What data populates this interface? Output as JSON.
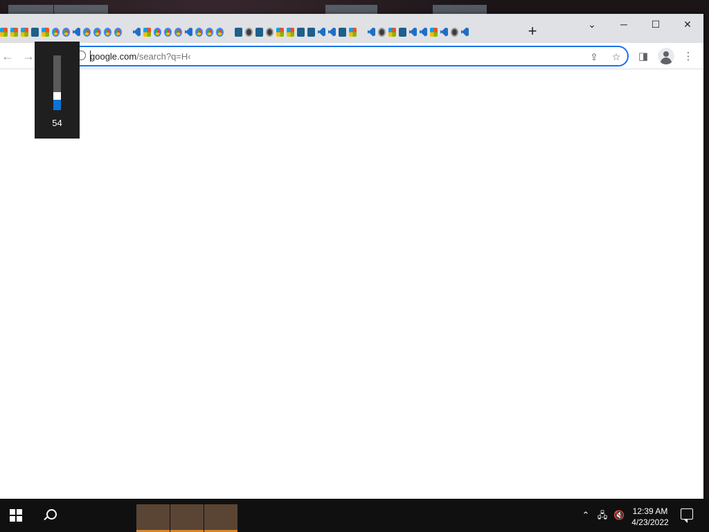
{
  "browser": {
    "tab_favicons": [
      "windows",
      "windows",
      "windows",
      "notion",
      "windows",
      "chrome",
      "chrome",
      "vscode",
      "chrome",
      "chrome",
      "chrome",
      "chrome",
      "gap",
      "vscode",
      "windows",
      "chrome",
      "chrome",
      "chrome",
      "vscode",
      "chrome",
      "chrome",
      "chrome",
      "gap",
      "notion",
      "github",
      "notion",
      "github",
      "windows",
      "windows",
      "notion",
      "notion",
      "vscode",
      "vscode",
      "notion",
      "windows",
      "gap",
      "vscode",
      "github",
      "windows",
      "notion",
      "vscode",
      "vscode",
      "windows",
      "vscode",
      "github",
      "vscode"
    ],
    "new_tab_label": "+",
    "window_controls": {
      "tab_search": "⌄",
      "minimize": "─",
      "maximize": "☐",
      "close": "✕"
    },
    "nav": {
      "back": "←",
      "forward": "→"
    },
    "omnibox": {
      "url_host": "google.com",
      "url_path": "/search?q=H‹"
    },
    "toolbar_icons": {
      "share": "⇪",
      "bookmark": "☆",
      "side_panel": "◨",
      "menu": "⋮"
    }
  },
  "volume_osd": {
    "value": "54",
    "level": 0.54
  },
  "taskbar": {
    "clock_time": "12:39 AM",
    "clock_date": "4/23/2022",
    "tray": {
      "chevron": "⌃",
      "network": "🖧",
      "volume": "🔇"
    }
  },
  "colors": {
    "accent": "#1a73e8",
    "volume_fill": "#0a74d8",
    "task_indicator": "#d9862a"
  }
}
